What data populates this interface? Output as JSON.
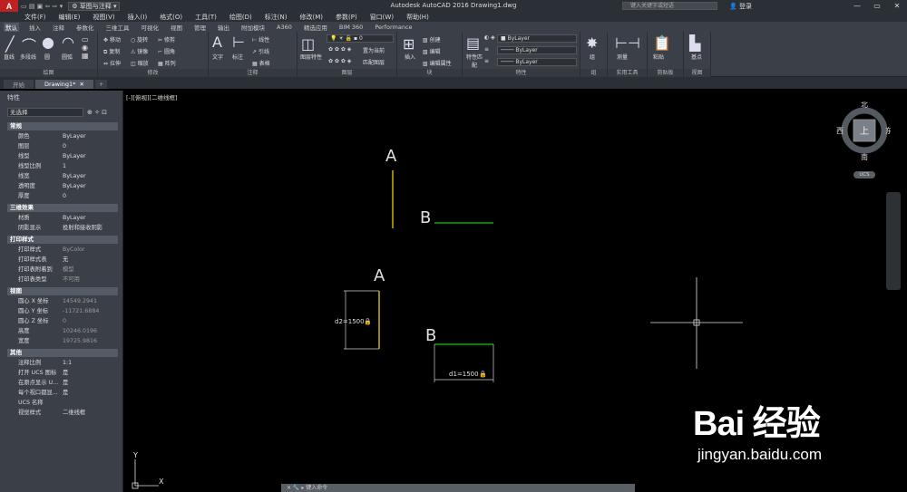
{
  "titlebar": {
    "workspace": "草图与注释",
    "app_title": "Autodesk AutoCAD 2016    Drawing1.dwg",
    "search_placeholder": "键入关键字或短语",
    "signin": "登录"
  },
  "menu": [
    "文件(F)",
    "编辑(E)",
    "视图(V)",
    "插入(I)",
    "格式(O)",
    "工具(T)",
    "绘图(D)",
    "标注(N)",
    "修改(M)",
    "参数(P)",
    "窗口(W)",
    "帮助(H)"
  ],
  "ribbon_tabs": [
    "默认",
    "插入",
    "注释",
    "参数化",
    "三维工具",
    "可视化",
    "视图",
    "管理",
    "输出",
    "附加模块",
    "A360",
    "精选应用",
    "BIM 360",
    "Performance"
  ],
  "ribbon": {
    "draw": {
      "name": "绘图",
      "line": "直线",
      "polyline": "多段线",
      "circle": "圆",
      "arc": "圆弧"
    },
    "modify": {
      "name": "修改",
      "move": "移动",
      "rotate": "旋转",
      "trim": "修剪",
      "copy": "复制",
      "mirror": "镜像",
      "fillet": "圆角",
      "stretch": "拉伸",
      "scale": "缩放",
      "array": "阵列"
    },
    "annotation": {
      "name": "注释",
      "text": "文字",
      "dim": "标注",
      "linear": "线性",
      "leader": "引线",
      "table": "表格"
    },
    "layers": {
      "name": "图层",
      "props": "图层特性",
      "current": "置为当前",
      "match": "匹配图层",
      "layer_value": "0"
    },
    "block": {
      "name": "块",
      "insert": "插入",
      "create": "创建",
      "edit": "编辑",
      "attrs": "编辑属性"
    },
    "properties": {
      "name": "特性",
      "match": "特性匹配",
      "color": "ByLayer",
      "lineweight": "ByLayer",
      "linetype": "ByLayer"
    },
    "groups": {
      "name": "组",
      "group": "组"
    },
    "utilities": {
      "name": "实用工具",
      "measure": "测量"
    },
    "clipboard": {
      "name": "剪贴板",
      "paste": "粘贴"
    },
    "view": {
      "name": "视图",
      "base": "基点"
    }
  },
  "doc_tabs": [
    "开始",
    "Drawing1*"
  ],
  "props_panel": {
    "title": "特性",
    "selection": "无选择",
    "sections": [
      {
        "name": "常规",
        "rows": [
          [
            "颜色",
            "ByLayer"
          ],
          [
            "图层",
            "0"
          ],
          [
            "线型",
            "ByLayer"
          ],
          [
            "线型比例",
            "1"
          ],
          [
            "线宽",
            "ByLayer"
          ],
          [
            "透明度",
            "ByLayer"
          ],
          [
            "厚度",
            "0"
          ]
        ]
      },
      {
        "name": "三维效果",
        "rows": [
          [
            "材质",
            "ByLayer"
          ],
          [
            "阴影显示",
            "投射和接收阴影"
          ]
        ]
      },
      {
        "name": "打印样式",
        "rows": [
          [
            "打印样式",
            "ByColor"
          ],
          [
            "打印样式表",
            "无"
          ],
          [
            "打印表附着到",
            "模型"
          ],
          [
            "打印表类型",
            "不可用"
          ]
        ]
      },
      {
        "name": "视图",
        "rows": [
          [
            "圆心 X 坐标",
            "14549.2941"
          ],
          [
            "圆心 Y 坐标",
            "-11721.6884"
          ],
          [
            "圆心 Z 坐标",
            "0"
          ],
          [
            "高度",
            "10246.0196"
          ],
          [
            "宽度",
            "19725.9816"
          ]
        ]
      },
      {
        "name": "其他",
        "rows": [
          [
            "注释比例",
            "1:1"
          ],
          [
            "打开 UCS 图标",
            "是"
          ],
          [
            "在原点显示 U...",
            "是"
          ],
          [
            "每个视口都显...",
            "是"
          ],
          [
            "UCS 名称",
            ""
          ],
          [
            "视觉样式",
            "二维线框"
          ]
        ]
      }
    ]
  },
  "viewport_label": "[-][俯视][二维线框]",
  "drawing": {
    "label_a1": "A",
    "label_b1": "B",
    "label_a2": "A",
    "label_b2": "B",
    "dim_d2": "d2=1500",
    "dim_d1": "d1=1500"
  },
  "viewcube": {
    "north": "北",
    "south": "南",
    "east": "东",
    "west": "西",
    "top": "上",
    "ucs": "UCS"
  },
  "cmdline": {
    "placeholder": "键入命令"
  },
  "ucs_icon": {
    "x": "X",
    "y": "Y"
  },
  "watermark": {
    "brand": "Bai 经验",
    "url": "jingyan.baidu.com"
  },
  "colors": {
    "yellow_line": "#c8b400",
    "green_line": "#00b000",
    "dim_color": "#cfcfcf",
    "bg": "#000000",
    "ui": "#3b4048"
  }
}
